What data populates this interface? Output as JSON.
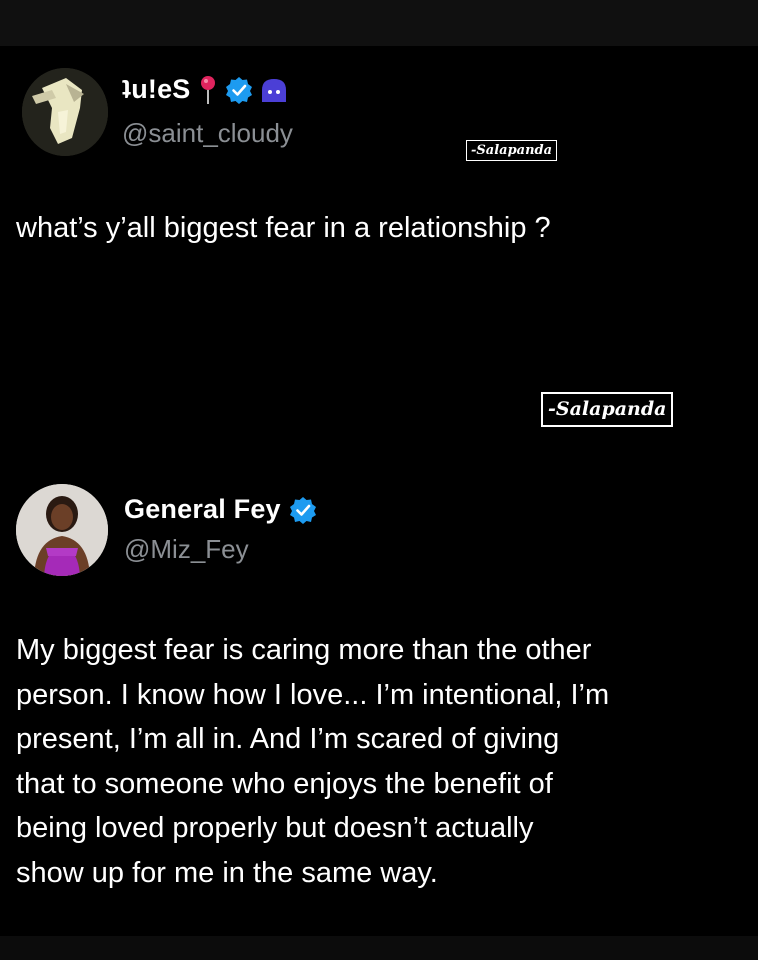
{
  "post_1": {
    "display_name": "ʇu!eS",
    "handle": "@saint_cloudy",
    "text": "what’s y’all biggest fear in a relationship ?"
  },
  "post_2": {
    "display_name": "General Fey",
    "handle": "@Miz_Fey",
    "text": "My biggest fear is caring more than the other\nperson. I know how I love... I’m intentional, I’m\npresent, I’m all in. And I’m scared of giving\nthat to someone who enjoys the benefit of\nbeing loved properly but doesn’t actually\nshow up for me in the same way."
  },
  "watermarks": {
    "small": "-Salapanda",
    "large": "-Salapanda"
  },
  "colors": {
    "background": "#000000",
    "handle_gray": "#8b8f94",
    "verified_blue": "#1d9bf0",
    "pin_red": "#e0245e",
    "ghost_purple": "#4b3fd6"
  },
  "icons": [
    "verified-badge-icon",
    "round-pushpin-icon",
    "ghost-emoji-icon"
  ]
}
